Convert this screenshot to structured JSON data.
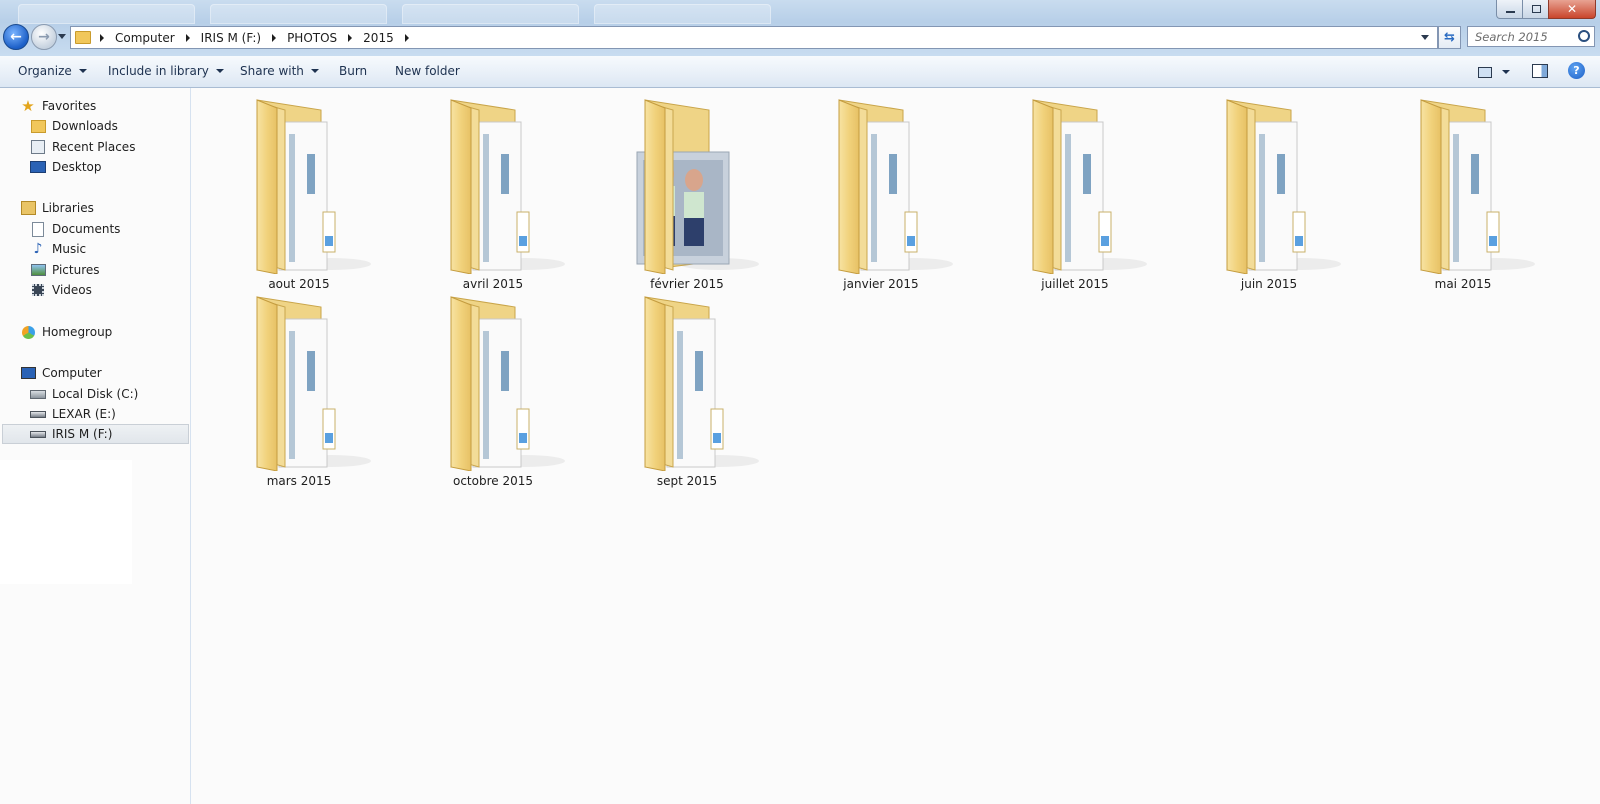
{
  "address": {
    "crumbs": [
      "Computer",
      "IRIS M (F:)",
      "PHOTOS",
      "2015"
    ],
    "search_placeholder": "Search 2015"
  },
  "toolbar": {
    "organize": "Organize",
    "include_in_library": "Include in library",
    "share_with": "Share with",
    "burn": "Burn",
    "new_folder": "New folder"
  },
  "sidebar": {
    "favorites": {
      "label": "Favorites",
      "items": [
        "Downloads",
        "Recent Places",
        "Desktop"
      ]
    },
    "libraries": {
      "label": "Libraries",
      "items": [
        "Documents",
        "Music",
        "Pictures",
        "Videos"
      ]
    },
    "homegroup": "Homegroup",
    "computer": {
      "label": "Computer",
      "items": [
        "Local Disk (C:)",
        "LEXAR (E:)",
        "IRIS M (F:)"
      ]
    },
    "selected": "IRIS M (F:)"
  },
  "folders": [
    "aout 2015",
    "avril 2015",
    "février 2015",
    "janvier 2015",
    "juillet 2015",
    "juin 2015",
    "mai 2015",
    "mars 2015",
    "octobre 2015",
    "sept 2015"
  ],
  "colors": {
    "accent": "#1c5fc7",
    "folder": "#f4d77f",
    "close": "#c9452c"
  }
}
